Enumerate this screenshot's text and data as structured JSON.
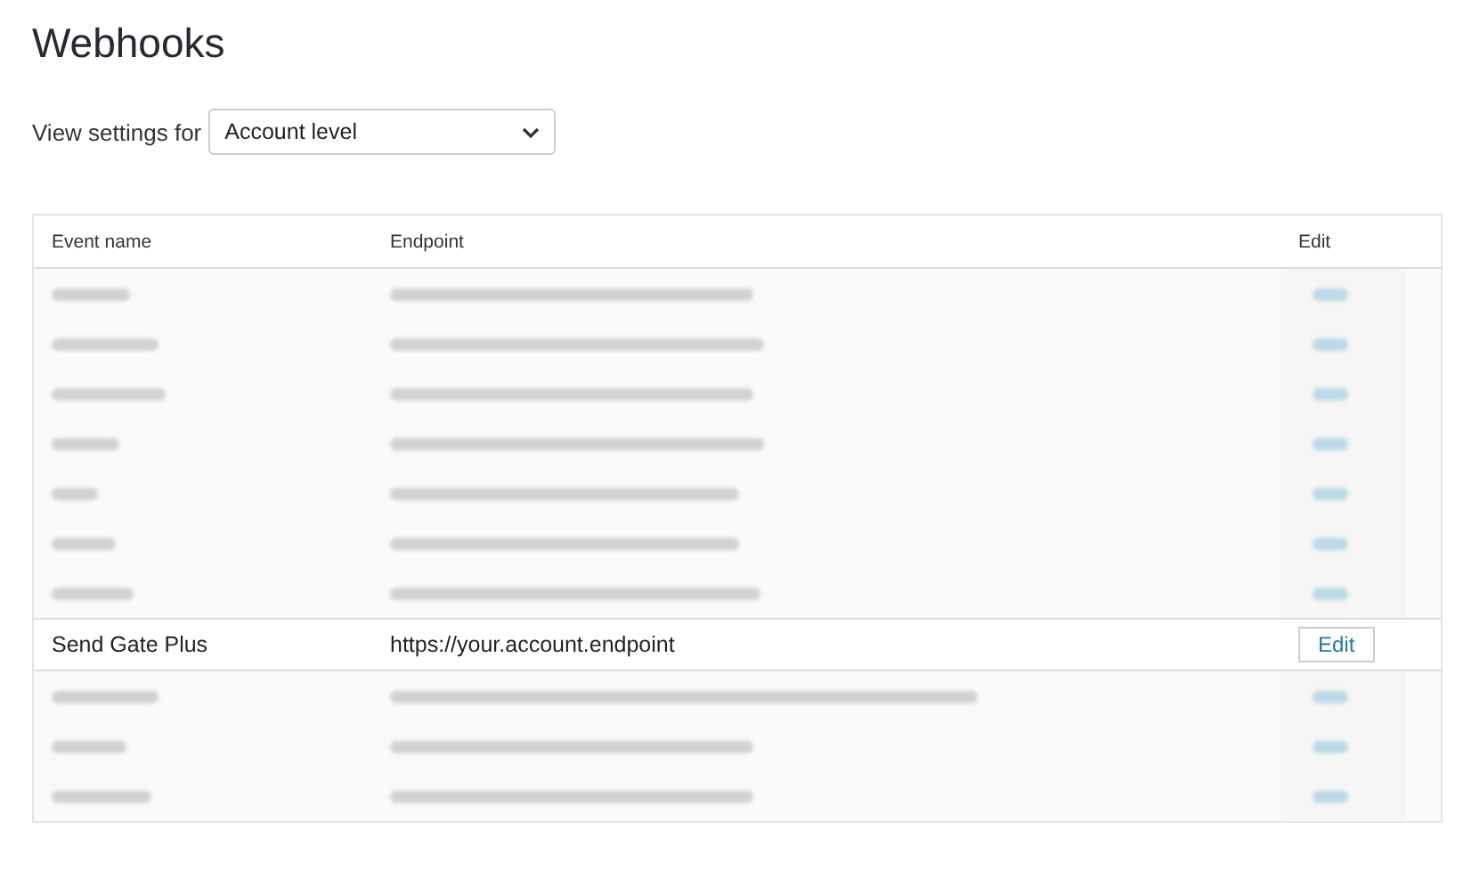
{
  "title": "Webhooks",
  "view_settings": {
    "label": "View settings for",
    "value": "Account level"
  },
  "table": {
    "columns": [
      "Event name",
      "Endpoint",
      "Edit"
    ],
    "rows": [
      {
        "kind": "redacted"
      },
      {
        "kind": "redacted"
      },
      {
        "kind": "redacted"
      },
      {
        "kind": "redacted"
      },
      {
        "kind": "redacted"
      },
      {
        "kind": "redacted"
      },
      {
        "kind": "redacted"
      },
      {
        "kind": "entry",
        "event": "Send Gate Plus",
        "endpoint": "https://your.account.endpoint",
        "action": "Edit"
      },
      {
        "kind": "redacted"
      },
      {
        "kind": "redacted"
      },
      {
        "kind": "redacted"
      }
    ]
  }
}
